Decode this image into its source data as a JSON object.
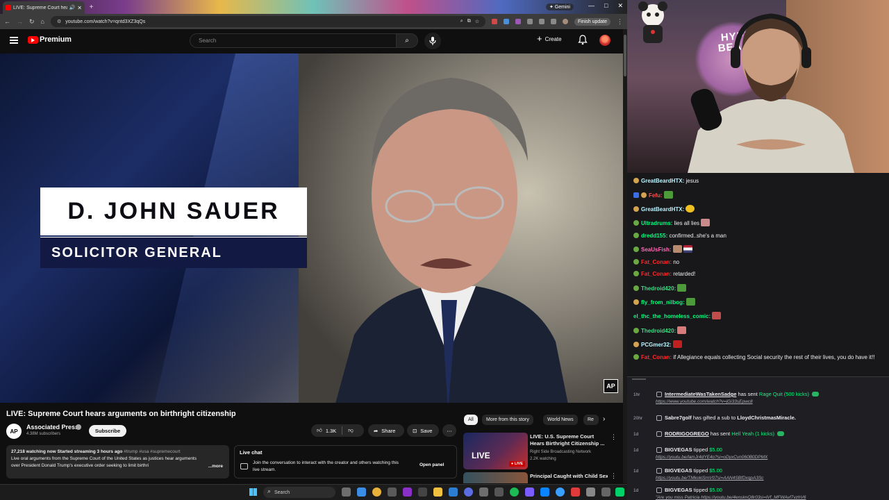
{
  "browser": {
    "tab_title": "LIVE: Supreme Court hears",
    "new_tab": "+",
    "gemini": "✦ Gemini",
    "url": "youtube.com/watch?v=qntd3XZ3qQs",
    "finish_update": "Finish update"
  },
  "youtube": {
    "brand": "Premium",
    "search_placeholder": "Search",
    "create_label": "Create",
    "video": {
      "lower_third_name": "D. JOHN SAUER",
      "lower_third_role": "SOLICITOR GENERAL",
      "watermark": "AP",
      "title": "LIVE: Supreme Court hears arguments on birthright citizenship"
    },
    "channel": {
      "avatar_text": "AP",
      "name": "Associated Press",
      "subscribers": "4.38M subscribers",
      "subscribe_label": "Subscribe"
    },
    "actions": {
      "likes": "1.3K",
      "share": "Share",
      "save": "Save"
    },
    "description": {
      "stats": "27,218 watching now  Started streaming 3 hours ago",
      "tags": " #trump #usa #supremecourt",
      "text": "Live oral arguments from the Supreme Court of the United States as justices hear arguments over President Donald Trump's executive order seeking to limit birthri",
      "more": "...more"
    },
    "live_chat": {
      "title": "Live chat",
      "text": "Join the conversation to interact with the creator and others watching this live stream.",
      "open": "Open panel"
    },
    "chips": [
      "All",
      "More from this story",
      "World News",
      "Re"
    ],
    "recommendations": [
      {
        "thumb_text": "LIVE",
        "badge": "● LIVE",
        "title": "LIVE: U.S. Supreme Court Hears Birthright Citizenship ...",
        "channel": "Right Side Broadcasting Network",
        "watching": "2.2K watching"
      },
      {
        "title": "Principal Caught with Child Sex Abuse Material"
      }
    ]
  },
  "taskbar": {
    "search_label": "Search"
  },
  "webcam": {
    "sign_text": "HYPE BEAST"
  },
  "chat": {
    "messages": [
      {
        "user": "GreatBeardHTX:",
        "text": " jesus",
        "color": "#b9f4ff"
      },
      {
        "user": "Fefu:",
        "text": "",
        "color": "#ff4f4f"
      },
      {
        "user": "GreatBeardHTX:",
        "text": "",
        "color": "#b9f4ff"
      },
      {
        "user": "Ultradrums:",
        "text": " lies all lies",
        "color": "#00ff7f"
      },
      {
        "user": "dredd155:",
        "text": " confirmed..she's a man",
        "color": "#00ff7f"
      },
      {
        "user": "SeaUsFish:",
        "text": "",
        "color": "#ff69b4"
      },
      {
        "user": "Fat_Conan:",
        "text": " no",
        "color": "#ff2a2a"
      },
      {
        "user": "Fat_Conan:",
        "text": " retarded!",
        "color": "#ff2a2a"
      },
      {
        "user": "Thedroid420:",
        "text": "",
        "color": "#3ddc84"
      },
      {
        "user": "fly_from_nilbog:",
        "text": "",
        "color": "#00ff7f"
      },
      {
        "user": "el_thc_the_homeless_comic:",
        "text": "",
        "color": "#00ff7f"
      },
      {
        "user": "Thedroid420:",
        "text": "",
        "color": "#3ddc84"
      },
      {
        "user": "PCGmer32:",
        "text": "",
        "color": "#b9f4ff"
      },
      {
        "user": "Fat_Conan:",
        "text": " if Allegiance equals collecting Social security the rest of their lives, you do have it!!",
        "color": "#ff2a2a"
      }
    ]
  },
  "feed": [
    {
      "age": "1hr",
      "user": "IntermediateWasTakenSadge",
      "mid": " has sent ",
      "amount": "Rage Quit (500 kicks)",
      "link": "https://www.youtube.com/watch?v=jGi33sEpwc8"
    },
    {
      "age": "20hr",
      "user": "Sabre7golf",
      "mid": " has gifted a sub to ",
      "amount": "LloydChristmasMiracle.",
      "link": ""
    },
    {
      "age": "1d",
      "user": "RODRIGOGREGO",
      "mid": " has sent ",
      "amount": "Hell Yeah (1 kicks)",
      "link": ""
    },
    {
      "age": "1d",
      "user": "BIGVEGAS",
      "mid": " tipped ",
      "amount": "$5.00",
      "link": "https://youtu.be/lamJr4dYE4o?si=oDyxCvn060B0DPMX"
    },
    {
      "age": "1d",
      "user": "BIGVEGAS",
      "mid": " tipped ",
      "amount": "$5.00",
      "link": "https://youtu.be/TMkokiSrnV07si=AAN4SBfDxqpA3Sc"
    },
    {
      "age": "1d",
      "user": "BIGVEGAS",
      "mid": " tipped ",
      "amount": "$5.00",
      "link": "\"Are you miss Patricia https://youtu.be/4ensknQ8r03si=lVf_MFWAvf7vzhV6"
    }
  ],
  "colors": {
    "youtube_red": "#ff0000",
    "twitch_bg": "#18181b",
    "kick_green": "#00ff7f"
  }
}
